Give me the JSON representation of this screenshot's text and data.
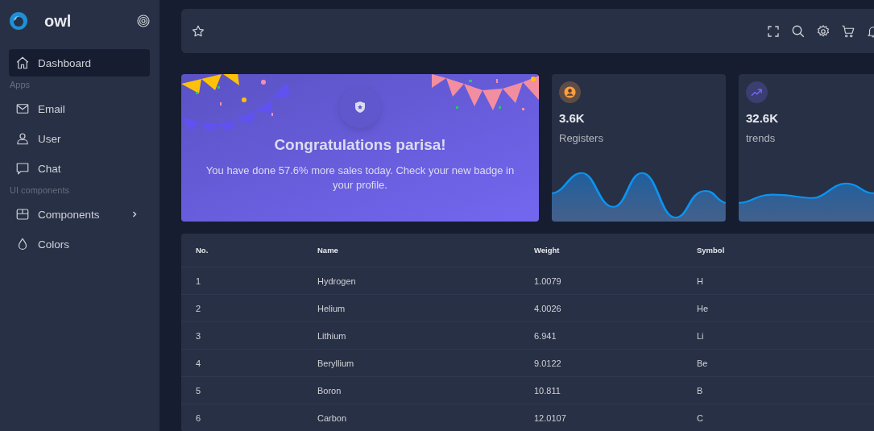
{
  "sidebar": {
    "brand": "owl",
    "items": [
      {
        "kind": "item",
        "label": "Dashboard",
        "selected": true,
        "has_submenu": false
      },
      {
        "kind": "section",
        "label": "Apps"
      },
      {
        "kind": "item",
        "label": "Email",
        "selected": false,
        "has_submenu": false
      },
      {
        "kind": "item",
        "label": "User",
        "selected": false,
        "has_submenu": false
      },
      {
        "kind": "item",
        "label": "Chat",
        "selected": false,
        "has_submenu": false
      },
      {
        "kind": "section",
        "label": "UI components"
      },
      {
        "kind": "item",
        "label": "Components",
        "selected": false,
        "has_submenu": true
      },
      {
        "kind": "item",
        "label": "Colors",
        "selected": false,
        "has_submenu": false
      }
    ]
  },
  "welcome": {
    "title": "Congratulations parisa!",
    "message": "You have done 57.6% more sales today. Check your new badge in your profile."
  },
  "stats": [
    {
      "value": "3.6K",
      "label": "Registers",
      "color": "#ff9f43"
    },
    {
      "value": "32.6K",
      "label": "trends",
      "color": "#7367f0"
    }
  ],
  "table": {
    "columns": [
      "No.",
      "Name",
      "Weight",
      "Symbol"
    ],
    "rows": [
      [
        "1",
        "Hydrogen",
        "1.0079",
        "H"
      ],
      [
        "2",
        "Helium",
        "4.0026",
        "He"
      ],
      [
        "3",
        "Lithium",
        "6.941",
        "Li"
      ],
      [
        "4",
        "Beryllium",
        "9.0122",
        "Be"
      ],
      [
        "5",
        "Boron",
        "10.811",
        "B"
      ],
      [
        "6",
        "Carbon",
        "12.0107",
        "C"
      ]
    ]
  }
}
